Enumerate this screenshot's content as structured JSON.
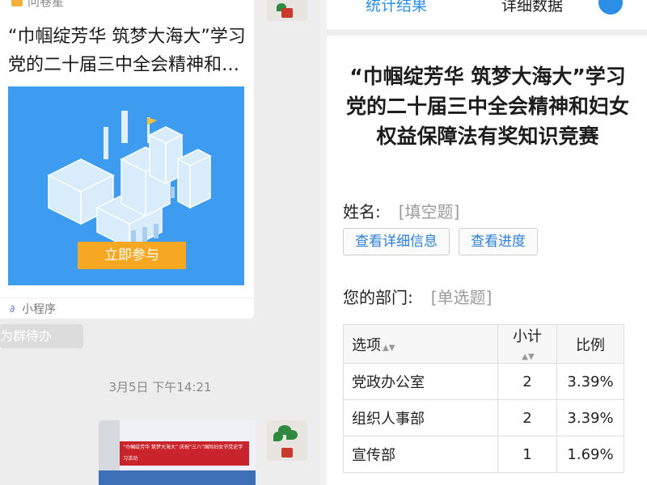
{
  "chat": {
    "card_top_partial": "问卷星",
    "card_title": "“巾帼绽芳华 筑梦大海大”学习党的二十届三中全会精神和妇女权益保障法有奖知识竞赛",
    "join_button": "立即参与",
    "mini_program_label": "小程序",
    "todo_chip": "设为群待办",
    "timestamp": "3月5日 下午14:21",
    "photo_banner": "“巾帼绽芳华 筑梦大海大” 庆祝“三八”国际妇女节党史学习活动"
  },
  "survey": {
    "tabs": [
      "统计结果",
      "详细数据"
    ],
    "title": "“巾帼绽芳华 筑梦大海大”学习党的二十届三中全会精神和妇女权益保障法有奖知识竞赛",
    "q_name_label": "姓名:",
    "q_name_type": "[填空题]",
    "btn_detail": "查看详细信息",
    "btn_progress": "查看进度",
    "q_dept_label": "您的部门:",
    "q_dept_type": "[单选题]",
    "table_headers": {
      "option": "选项",
      "subtotal": "小计",
      "percent": "比例"
    },
    "rows": [
      {
        "option": "党政办公室",
        "subtotal": "2",
        "percent": "3.39%"
      },
      {
        "option": "组织人事部",
        "subtotal": "2",
        "percent": "3.39%"
      },
      {
        "option": "宣传部",
        "subtotal": "1",
        "percent": "1.69%"
      }
    ]
  },
  "colors": {
    "accent_blue": "#2b8fe8",
    "join_orange": "#f7a823",
    "card_blue": "#3d9bf0"
  }
}
